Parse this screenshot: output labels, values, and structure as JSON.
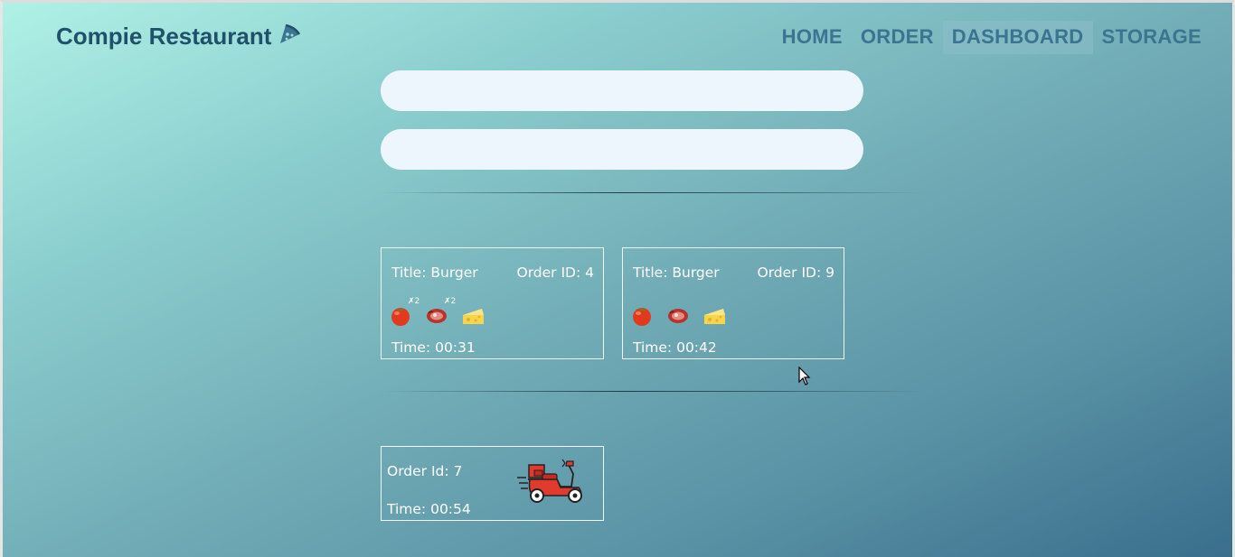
{
  "brand": {
    "name": "Compie Restaurant",
    "icon": "pizza-slice-icon"
  },
  "nav": {
    "items": [
      "HOME",
      "ORDER",
      "DASHBOARD",
      "STORAGE"
    ],
    "active": "DASHBOARD"
  },
  "inputs": [
    {
      "value": "",
      "placeholder": ""
    },
    {
      "value": "",
      "placeholder": ""
    }
  ],
  "orders": [
    {
      "title": "Title: Burger",
      "order_id": "Order ID: 4",
      "ingredients": [
        {
          "icon": "tomato-icon",
          "qty": "✗2"
        },
        {
          "icon": "meat-icon",
          "qty": "✗2"
        },
        {
          "icon": "cheese-icon",
          "qty": ""
        }
      ],
      "time": "Time: 00:31"
    },
    {
      "title": "Title: Burger",
      "order_id": "Order ID: 9",
      "ingredients": [
        {
          "icon": "tomato-icon",
          "qty": ""
        },
        {
          "icon": "meat-icon",
          "qty": ""
        },
        {
          "icon": "cheese-icon",
          "qty": ""
        }
      ],
      "time": "Time: 00:42"
    }
  ],
  "deliveries": [
    {
      "order_id": "Order Id: 7",
      "time": "Time: 00:54",
      "icon": "delivery-scooter-icon"
    }
  ]
}
